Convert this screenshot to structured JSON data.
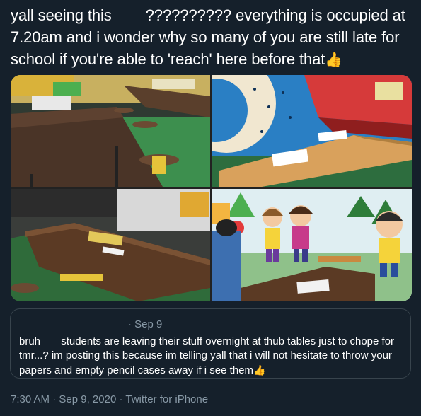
{
  "tweet": {
    "text_part1": "yall seeing this        ?????????? everything is occupied at 7.20am and i wonder why so many of you are still late for school if you're able to 'reach' here before that",
    "emoji": "👍"
  },
  "media": {
    "photo_count": 4
  },
  "quote": {
    "date": "· Sep 9",
    "text": "bruh       students are leaving their stuff overnight at thub tables just to chope for tmr...? im posting this because im telling yall that i will not hesitate to throw your papers and empty pencil cases away if i see them",
    "emoji": "👍"
  },
  "meta": {
    "time": "7:30 AM",
    "separator1": " · ",
    "date": "Sep 9, 2020",
    "separator2": " · ",
    "source": "Twitter for iPhone"
  },
  "colors": {
    "background": "#15202b",
    "text": "#ffffff",
    "secondary": "#8899a6",
    "border": "#38444d"
  }
}
